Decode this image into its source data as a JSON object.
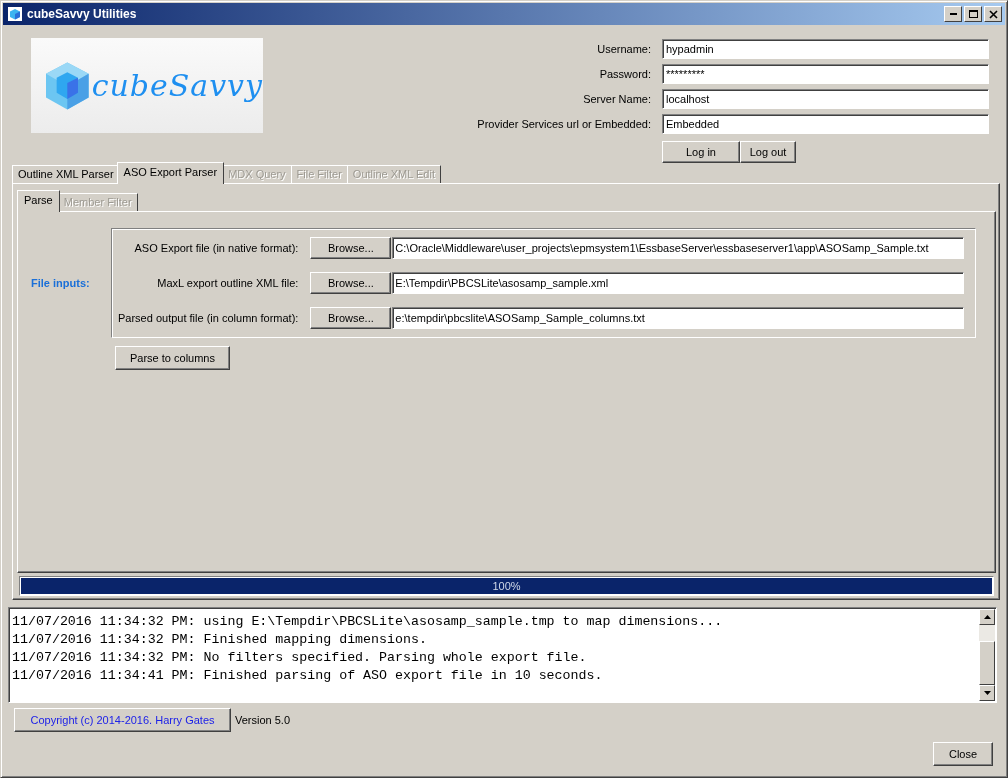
{
  "window": {
    "title": "cubeSavvy Utilities"
  },
  "logo": {
    "text": "cubeSavvy"
  },
  "login": {
    "fields": [
      {
        "label": "Username:",
        "value": "hypadmin"
      },
      {
        "label": "Password:",
        "value": "*********"
      },
      {
        "label": "Server Name:",
        "value": "localhost"
      },
      {
        "label": "Provider Services url or Embedded:",
        "value": "Embedded"
      }
    ],
    "buttons": [
      "Log in",
      "Log out"
    ]
  },
  "tabs": [
    {
      "label": "Outline XML Parser",
      "selected": false,
      "disabled": false
    },
    {
      "label": "ASO Export Parser",
      "selected": true,
      "disabled": false
    },
    {
      "label": "MDX Query",
      "selected": false,
      "disabled": true
    },
    {
      "label": "File Filter",
      "selected": false,
      "disabled": true
    },
    {
      "label": "Outline XML Edit",
      "selected": false,
      "disabled": true
    }
  ],
  "subtabs": [
    {
      "label": "Parse",
      "selected": true,
      "disabled": false
    },
    {
      "label": "Member Filter",
      "selected": false,
      "disabled": true
    }
  ],
  "file_inputs": {
    "heading": "File inputs:",
    "rows": [
      {
        "label": "ASO Export file (in native format):",
        "button": "Browse...",
        "value": "C:\\Oracle\\Middleware\\user_projects\\epmsystem1\\EssbaseServer\\essbaseserver1\\app\\ASOSamp_Sample.txt"
      },
      {
        "label": "MaxL export outline XML file:",
        "button": "Browse...",
        "value": "E:\\Tempdir\\PBCSLite\\asosamp_sample.xml"
      },
      {
        "label": "Parsed output file (in column format):",
        "button": "Browse...",
        "value": "e:\\tempdir\\pbcslite\\ASOSamp_Sample_columns.txt"
      }
    ]
  },
  "parse_button": "Parse to columns",
  "progress": {
    "level": 1,
    "reading": "100%"
  },
  "log": {
    "lines": [
      "11/07/2016 11:34:32 PM: using E:\\Tempdir\\PBCSLite\\asosamp_sample.tmp to map dimensions...",
      "11/07/2016 11:34:32 PM: Finished mapping dimensions.",
      "11/07/2016 11:34:32 PM: No filters specified. Parsing whole export file.",
      "11/07/2016 11:34:41 PM: Finished parsing of ASO export file in 10 seconds."
    ]
  },
  "footer": {
    "copyright": "Copyright (c) 2014-2016. Harry Gates",
    "version": "Version 5.0",
    "close": "Close"
  }
}
